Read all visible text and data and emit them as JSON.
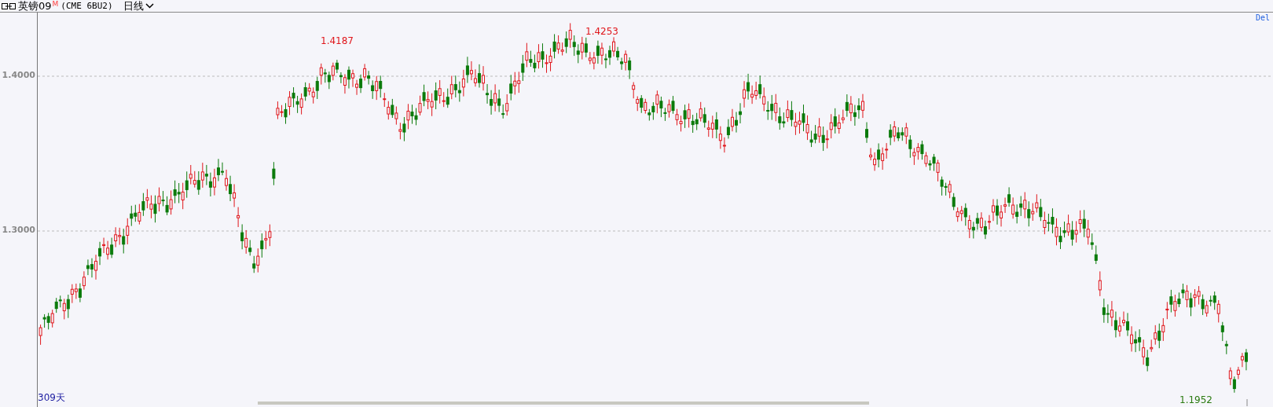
{
  "header": {
    "symbol": "英镑09",
    "badge": "M",
    "contract": "(CME 6BU2)",
    "period": "日线"
  },
  "chart": {
    "corner_label": "Del",
    "bar_count": "309天",
    "price_labels": [
      {
        "text": "1.4000"
      },
      {
        "text": "1.3000"
      }
    ],
    "markers": [
      {
        "text": "1.4187",
        "kind": "high"
      },
      {
        "text": "1.4253",
        "kind": "high"
      },
      {
        "text": "1.1952",
        "kind": "low"
      }
    ]
  }
}
